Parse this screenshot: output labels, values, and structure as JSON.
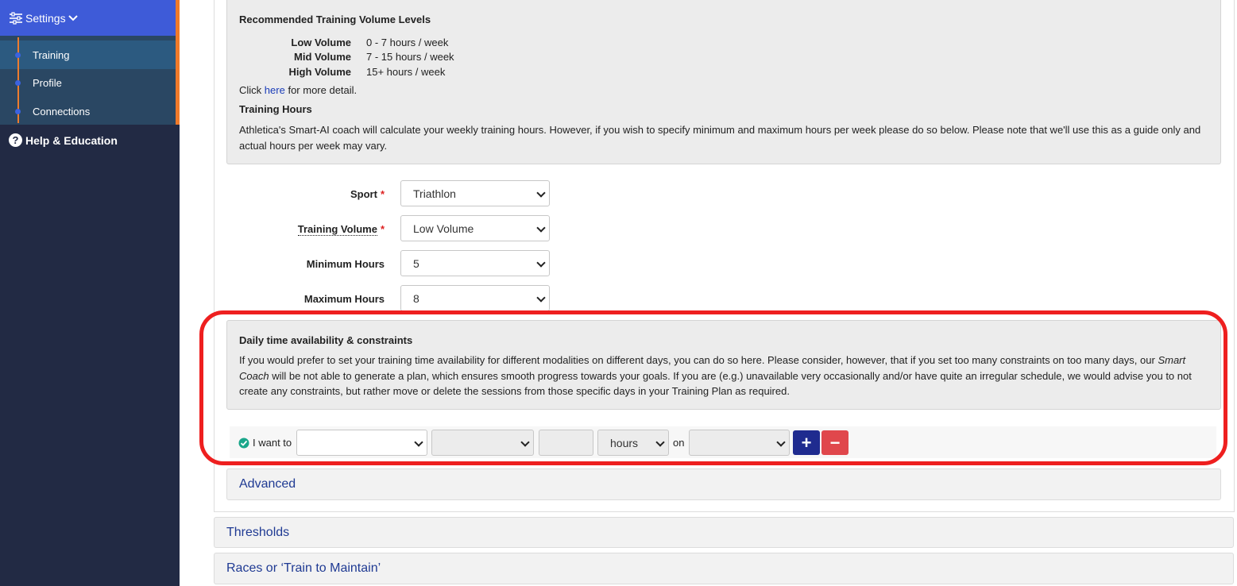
{
  "sidebar": {
    "settings_label": "Settings",
    "items": [
      {
        "label": "Training",
        "active": true
      },
      {
        "label": "Profile",
        "active": false
      },
      {
        "label": "Connections",
        "active": false
      }
    ],
    "help_label": "Help & Education"
  },
  "volume_levels": {
    "title": "Recommended Training Volume Levels",
    "rows": [
      {
        "label": "Low Volume",
        "value": "0 - 7 hours / week"
      },
      {
        "label": "Mid Volume",
        "value": "7 - 15 hours / week"
      },
      {
        "label": "High Volume",
        "value": "15+ hours / week"
      }
    ],
    "click_prefix": "Click",
    "link_text": "here",
    "click_suffix": "for more detail."
  },
  "training_hours": {
    "title": "Training Hours",
    "text": "Athletica's Smart-AI coach will calculate your weekly training hours. However, if you wish to specify minimum and maximum hours per week please do so below. Please note that we'll use this as a guide only and actual hours per week may vary."
  },
  "form": {
    "sport_label": "Sport",
    "sport_value": "Triathlon",
    "volume_label": "Training Volume",
    "volume_value": "Low Volume",
    "min_label": "Minimum Hours",
    "min_value": "5",
    "max_label": "Maximum Hours",
    "max_value": "8",
    "required_mark": "*"
  },
  "daily": {
    "title": "Daily time availability & constraints",
    "text_1": "If you would prefer to set your training time availability for different modalities on different days, you can do so here. Please consider, however, that if you set too many constraints on too many days, our ",
    "text_italic": "Smart Coach",
    "text_2": " will be not able to generate a plan, which ensures smooth progress towards your goals. If you are (e.g.) unavailable very occasionally and/or have quite an irregular schedule, we would advise you to not create any constraints, but rather move or delete the sessions from those specific days in your Training Plan as required."
  },
  "constraint": {
    "i_want_to": "I want to",
    "unit": "hours",
    "on": "on",
    "add": "+",
    "remove": "−"
  },
  "accordions": {
    "advanced": "Advanced",
    "thresholds": "Thresholds",
    "races": "Races or ‘Train to Maintain’"
  },
  "colors": {
    "sidebar_bg": "#222a44",
    "settings_bg": "#3e5bd8",
    "accent_orange": "#f07a2a",
    "link_blue": "#1f3a93",
    "add_button": "#1f2b8f",
    "remove_button": "#e0474c",
    "highlight_red": "#ee1f1f",
    "check_green": "#1aa68a"
  }
}
